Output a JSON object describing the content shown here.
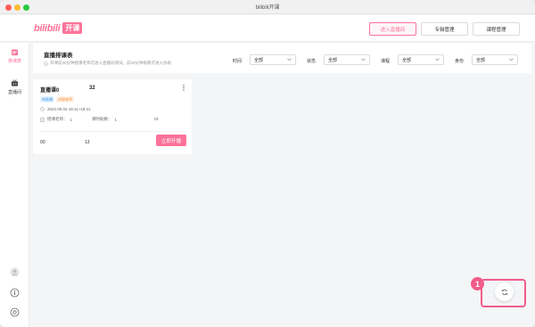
{
  "window": {
    "title": "bilibili开课"
  },
  "logo": {
    "text": "bilibili",
    "tag": "开课"
  },
  "topnav": {
    "enter_room": "进入直播间",
    "album_manage": "专辑管理",
    "course_manage": "课程管理"
  },
  "sidebar": {
    "items": [
      {
        "label": "排课表",
        "icon": "calendar-icon",
        "active": true
      },
      {
        "label": "直播间",
        "icon": "tv-icon",
        "active": false
      }
    ]
  },
  "header": {
    "title": "直播排课表",
    "subtitle": "开课前30分钟授课老师可进入直播间测试，前20分钟助教可进入协助",
    "filters": [
      {
        "label": "时间",
        "value": "全部"
      },
      {
        "label": "状态",
        "value": "全部"
      },
      {
        "label": "课程",
        "value": "全部"
      },
      {
        "label": "身份",
        "value": "全部"
      }
    ]
  },
  "card": {
    "title": "直播课0",
    "number": "32",
    "tags": [
      "待直播",
      "讲课老师"
    ],
    "time": "2022.09.02 18:11~18:41",
    "teacher_label": "授课老师：",
    "teacher_value": "1",
    "duration_label": "课时助教：",
    "duration_value": "1",
    "extra_value": "01",
    "foot_left": "00",
    "foot_mid": "13",
    "start_label": "立即开播"
  },
  "overlay": {
    "step": "1"
  },
  "colors": {
    "accent": "#fb7299",
    "highlight": "#f25c8a"
  }
}
